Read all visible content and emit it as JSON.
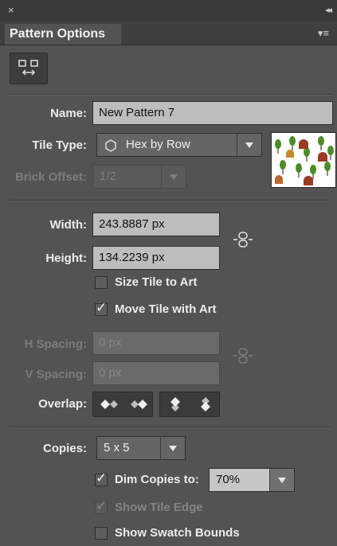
{
  "window": {
    "close_glyph": "×",
    "collapse_glyph": "◂◂"
  },
  "panel": {
    "title": "Pattern Options",
    "menu_glyph": "▾≡"
  },
  "tool": {
    "icon": "edit-tile-icon"
  },
  "name": {
    "label": "Name:",
    "value": "New Pattern 7"
  },
  "tile_type": {
    "label": "Tile Type:",
    "value": "Hex by Row",
    "icon": "hexagon-icon"
  },
  "brick_offset": {
    "label": "Brick Offset:",
    "value": "1/2"
  },
  "width": {
    "label": "Width:",
    "value": "243.8887 px"
  },
  "height": {
    "label": "Height:",
    "value": "134.2239 px"
  },
  "size_tile_to_art": {
    "label": "Size Tile to Art",
    "checked": false
  },
  "move_tile_with_art": {
    "label": "Move Tile with Art",
    "checked": true
  },
  "h_spacing": {
    "label": "H Spacing:",
    "value": "0 px"
  },
  "v_spacing": {
    "label": "V Spacing:",
    "value": "0 px"
  },
  "overlap": {
    "label": "Overlap:"
  },
  "copies": {
    "label": "Copies:",
    "value": "5 x 5"
  },
  "dim_copies": {
    "label": "Dim Copies to:",
    "checked": true,
    "value": "70%"
  },
  "show_tile_edge": {
    "label": "Show Tile Edge",
    "checked": true
  },
  "show_swatch_bounds": {
    "label": "Show Swatch Bounds",
    "checked": false
  },
  "colors": {
    "panel_bg": "#535353",
    "field_bg": "#bdbdbd",
    "tree_green": "#4e8a2a",
    "house_red": "#9a3b22"
  }
}
